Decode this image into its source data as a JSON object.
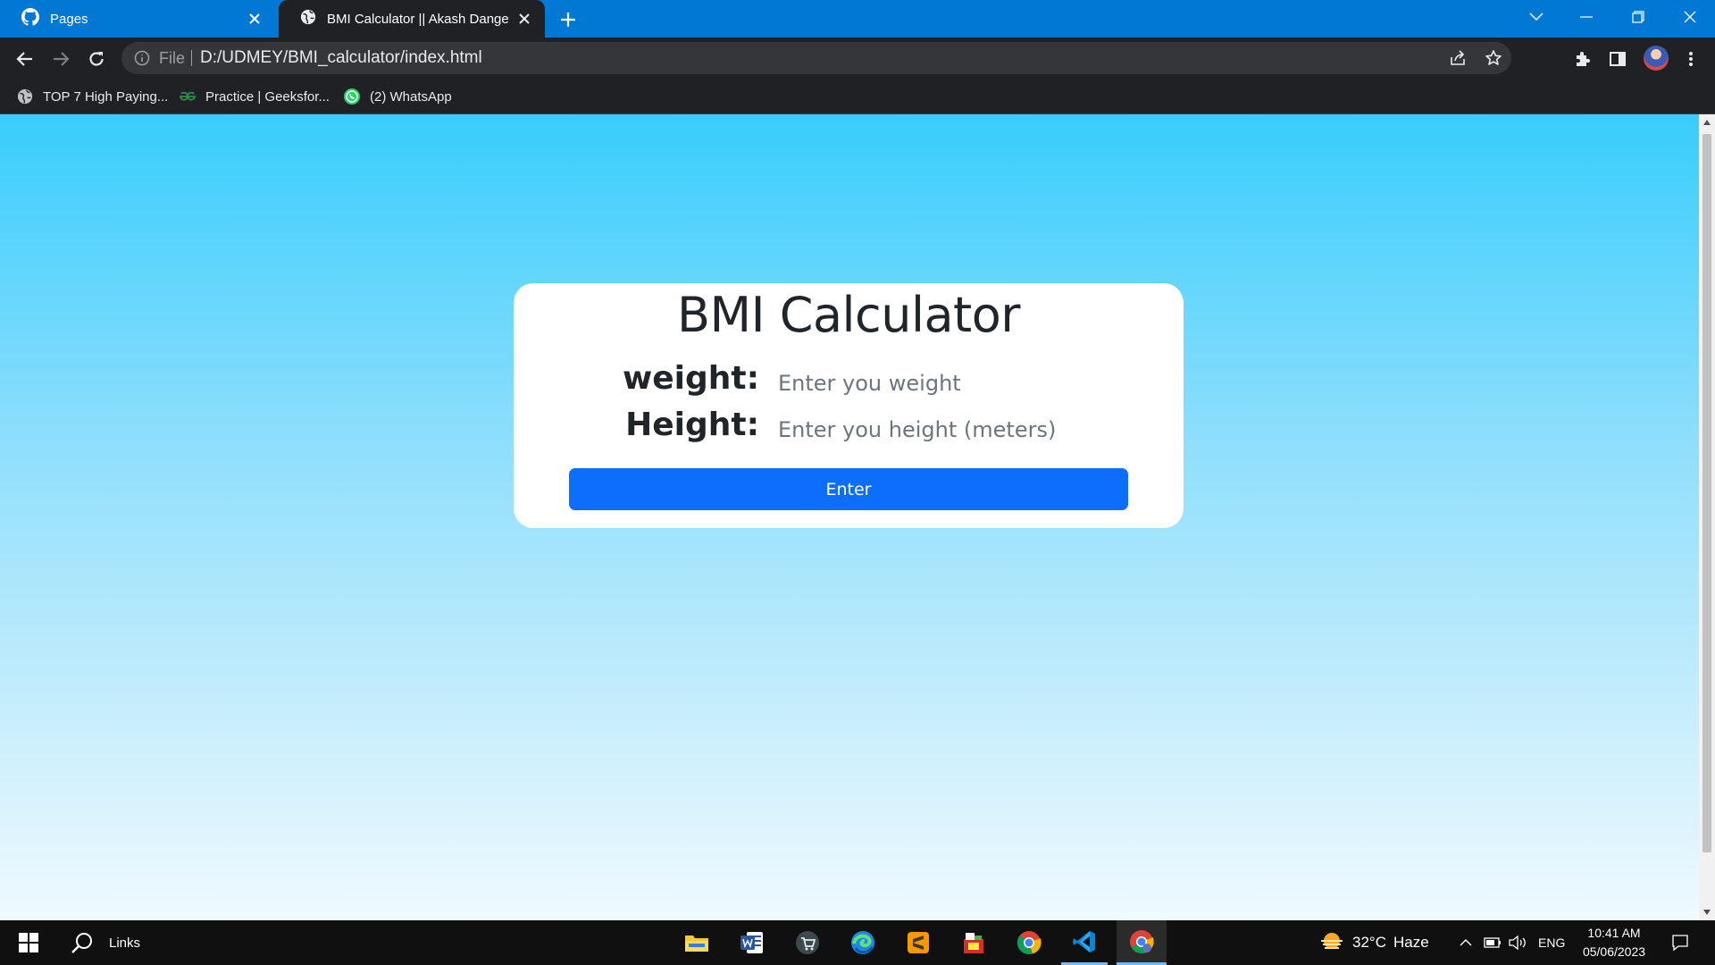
{
  "browser": {
    "tabs": [
      {
        "title": "Pages",
        "icon": "github-icon",
        "active": false
      },
      {
        "title": "BMI Calculator || Akash Dange",
        "icon": "globe-icon",
        "active": true
      }
    ],
    "omnibox": {
      "scheme_label": "File",
      "url": "D:/UDMEY/BMI_calculator/index.html"
    },
    "bookmarks": [
      {
        "label": "TOP 7 High Paying...",
        "icon": "globe-icon"
      },
      {
        "label": "Practice | Geeksfor...",
        "icon": "geeksforgeeks-icon"
      },
      {
        "label": "(2) WhatsApp",
        "icon": "whatsapp-icon"
      }
    ]
  },
  "page": {
    "title": "BMI Calculator",
    "weight_label": "weight:",
    "weight_placeholder": "Enter you weight",
    "weight_value": "",
    "height_label": "Height:",
    "height_placeholder": "Enter you height (meters)",
    "height_value": "",
    "button_label": "Enter",
    "colors": {
      "background_top": "#38cdfc",
      "background_bottom": "#effaff",
      "button": "#0d6efd",
      "card": "#ffffff"
    }
  },
  "taskbar": {
    "search_label": "Links",
    "apps": [
      "file-explorer-icon",
      "word-icon",
      "store-icon",
      "edge-icon",
      "sublime-text-icon",
      "app-icon",
      "chrome-icon",
      "vscode-icon",
      "chrome-profile-icon"
    ],
    "weather": {
      "temp": "32°C",
      "condition": "Haze"
    },
    "language": "ENG",
    "time": "10:41 AM",
    "date": "05/06/2023"
  }
}
